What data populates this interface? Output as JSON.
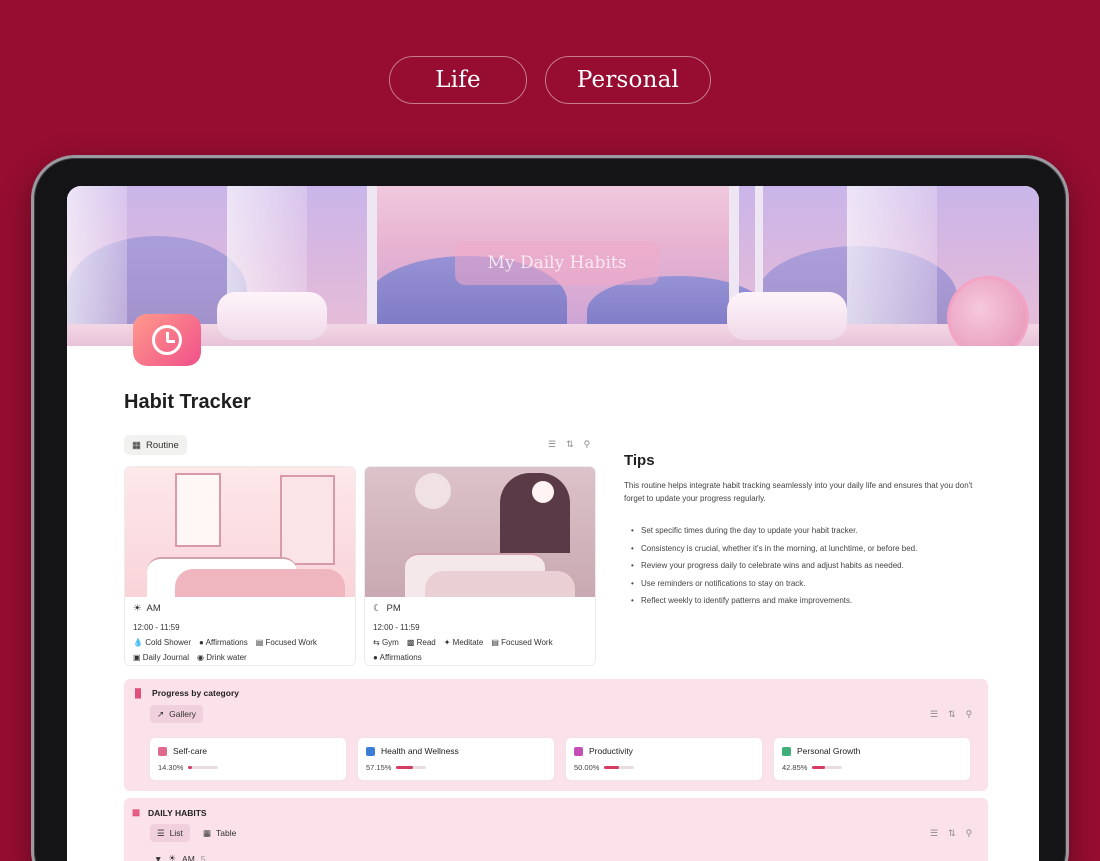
{
  "tags": [
    "Life",
    "Personal"
  ],
  "banner": {
    "title": "My Daily Habits"
  },
  "page": {
    "title": "Habit Tracker"
  },
  "routine": {
    "tab_label": "Routine",
    "cards": [
      {
        "name": "AM",
        "time": "12:00 - 11:59",
        "tags": [
          "Cold Shower",
          "Affirmations",
          "Focused Work",
          "Daily Journal",
          "Drink water"
        ]
      },
      {
        "name": "PM",
        "time": "12:00 - 11:59",
        "tags": [
          "Gym",
          "Read",
          "Meditate",
          "Focused Work",
          "Affirmations"
        ]
      }
    ]
  },
  "tips": {
    "title": "Tips",
    "intro": "This routine helps integrate habit tracking seamlessly into your daily life and ensures that you don't forget to update your progress regularly.",
    "items": [
      "Set specific times during the day to update your habit tracker.",
      "Consistency is crucial, whether it's in the morning, at lunchtime, or before bed.",
      "Review your progress daily to celebrate wins and adjust habits as needed.",
      "Use reminders or notifications to stay on track.",
      "Reflect weekly to identify patterns and make improvements."
    ]
  },
  "progress": {
    "title": "Progress by category",
    "view_label": "Gallery",
    "categories": [
      {
        "name": "Self-care",
        "value_text": "14.30%",
        "fraction": 0.143,
        "icon_color": "#e06a8e"
      },
      {
        "name": "Health and Wellness",
        "value_text": "57.15%",
        "fraction": 0.5715,
        "icon_color": "#3a7fd5"
      },
      {
        "name": "Productivity",
        "value_text": "50.00%",
        "fraction": 0.5,
        "icon_color": "#c450b7"
      },
      {
        "name": "Personal Growth",
        "value_text": "42.85%",
        "fraction": 0.4285,
        "icon_color": "#3fae7a"
      }
    ]
  },
  "daily_habits": {
    "title": "DAILY HABITS",
    "views": [
      "List",
      "Table"
    ],
    "group_label": "AM",
    "group_count": "5"
  },
  "colors": {
    "background": "#960d31",
    "accent": "#d43c64",
    "panel": "#fbe1ea"
  }
}
